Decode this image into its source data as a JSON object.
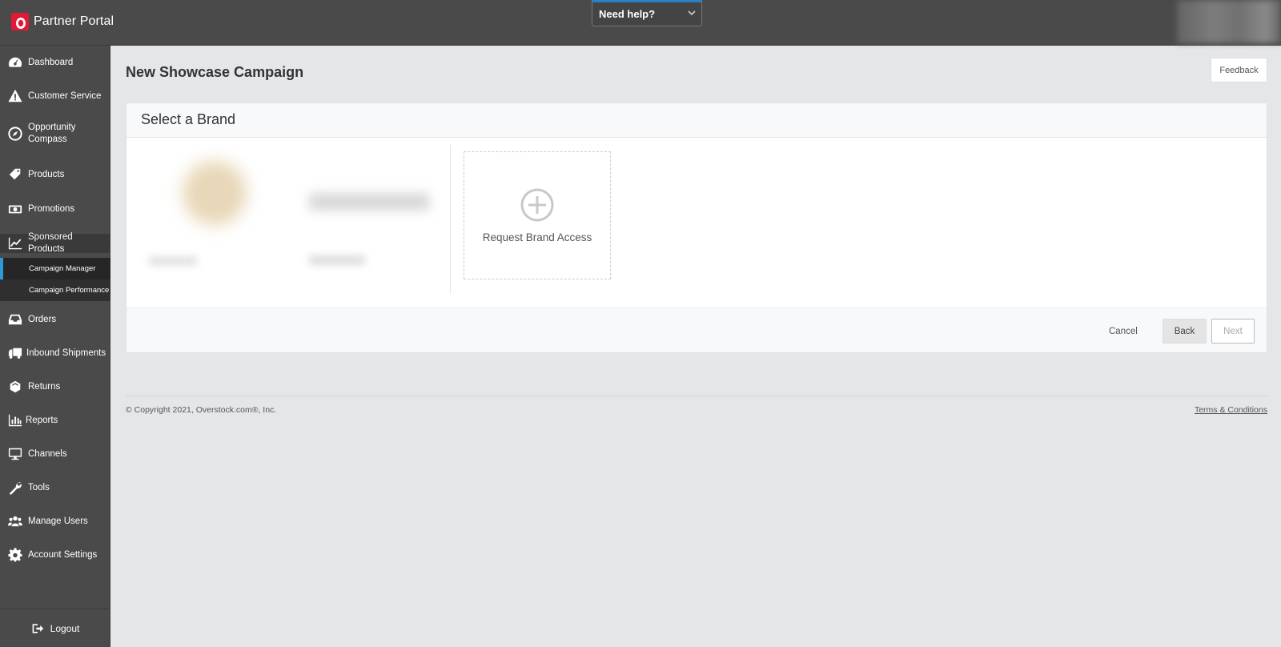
{
  "app": {
    "title": "Partner Portal",
    "brand_color": "#e31837"
  },
  "header": {
    "help_label": "Need help?"
  },
  "sidebar": {
    "items": [
      {
        "label": "Dashboard",
        "icon": "dashboard-icon"
      },
      {
        "label": "Customer Service",
        "icon": "warning-icon"
      },
      {
        "label": "Opportunity Compass",
        "icon": "compass-icon"
      },
      {
        "label": "Products",
        "icon": "tag-icon"
      },
      {
        "label": "Promotions",
        "icon": "money-icon"
      },
      {
        "label": "Sponsored Products",
        "icon": "chart-line-icon"
      },
      {
        "label": "Orders",
        "icon": "inbox-icon"
      },
      {
        "label": "Inbound Shipments",
        "icon": "truck-icon"
      },
      {
        "label": "Returns",
        "icon": "returns-icon"
      },
      {
        "label": "Reports",
        "icon": "bar-chart-icon"
      },
      {
        "label": "Channels",
        "icon": "monitor-icon"
      },
      {
        "label": "Tools",
        "icon": "wrench-icon"
      },
      {
        "label": "Manage Users",
        "icon": "users-icon"
      },
      {
        "label": "Account Settings",
        "icon": "gear-icon"
      }
    ],
    "sub_items": [
      {
        "label": "Campaign Manager"
      },
      {
        "label": "Campaign Performance"
      }
    ],
    "logout_label": "Logout"
  },
  "main": {
    "title": "New Showcase Campaign",
    "feedback_label": "Feedback",
    "panel_title": "Select a Brand",
    "request_access_label": "Request Brand Access",
    "buttons": {
      "cancel": "Cancel",
      "back": "Back",
      "next": "Next"
    }
  },
  "footer": {
    "copyright": "© Copyright 2021, Overstock.com®, Inc.",
    "terms": "Terms & Conditions"
  }
}
